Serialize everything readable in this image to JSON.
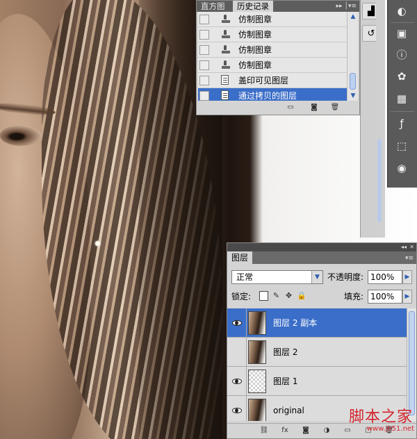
{
  "history_panel": {
    "tabs": [
      "直方图",
      "历史记录"
    ],
    "active_tab": "历史记录",
    "items": [
      {
        "label": "仿制图章",
        "icon": "clone-stamp-icon"
      },
      {
        "label": "仿制图章",
        "icon": "clone-stamp-icon"
      },
      {
        "label": "仿制图章",
        "icon": "clone-stamp-icon"
      },
      {
        "label": "仿制图章",
        "icon": "clone-stamp-icon"
      },
      {
        "label": "盖印可见图层",
        "icon": "document-icon"
      },
      {
        "label": "通过拷贝的图层",
        "icon": "document-icon",
        "selected": true
      }
    ],
    "footer_buttons": [
      "new-document-from-state-icon",
      "create-snapshot-icon",
      "delete-state-icon"
    ]
  },
  "panel_dock": {
    "buttons": [
      "histogram-icon",
      "history-icon"
    ],
    "strip_icons": [
      "navigator-icon",
      "swatches-icon",
      "info-icon",
      "color-icon",
      "grid-icon",
      "styles-icon",
      "transform-icon",
      "masks-icon"
    ]
  },
  "layers_panel": {
    "tab": "图层",
    "blend_mode": "正常",
    "opacity_label": "不透明度:",
    "opacity_value": "100%",
    "lock_label": "锁定:",
    "fill_label": "填充:",
    "fill_value": "100%",
    "layers": [
      {
        "name": "图层 2 副本",
        "visible": true,
        "thumb": "photo",
        "selected": true
      },
      {
        "name": "图层 2",
        "visible": false,
        "thumb": "photo",
        "selected": false
      },
      {
        "name": "图层 1",
        "visible": true,
        "thumb": "empty",
        "selected": false
      },
      {
        "name": "original",
        "visible": true,
        "thumb": "photo",
        "selected": false
      }
    ],
    "footer_buttons": [
      "link-layers-icon",
      "fx-icon",
      "add-mask-icon",
      "adjustment-icon",
      "group-icon",
      "new-layer-icon",
      "delete-layer-icon"
    ]
  },
  "watermark": {
    "main": "脚本之家",
    "sub": "www.jb51.net"
  },
  "colors": {
    "selection": "#3b6ec8",
    "panel_bg": "#d4d4d4",
    "watermark": "#d4232c"
  }
}
